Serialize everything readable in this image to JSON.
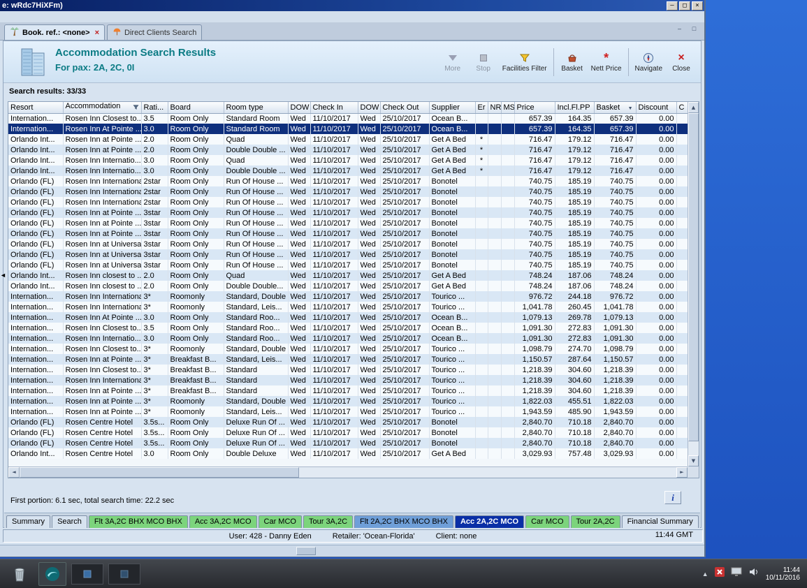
{
  "window": {
    "title": "e: wRdc7HiXFm)",
    "minimize_label": "–",
    "maximize_label": "□",
    "close_label": "×"
  },
  "tabs": [
    {
      "label": "Book. ref.: <none>",
      "active": true
    },
    {
      "label": "Direct Clients Search",
      "active": false
    }
  ],
  "header": {
    "title": "Accommodation Search Results",
    "subtitle": "For pax: 2A, 2C, 0I",
    "toolbar": [
      {
        "label": "More",
        "icon": "chevron-down-icon",
        "disabled": true
      },
      {
        "label": "Stop",
        "icon": "stop-icon",
        "disabled": true
      },
      {
        "label": "Facilities Filter",
        "icon": "funnel-icon",
        "sep_after": true
      },
      {
        "label": "Basket",
        "icon": "basket-icon"
      },
      {
        "label": "Nett Price",
        "icon": "asterisk-icon",
        "sep_after": true
      },
      {
        "label": "Navigate",
        "icon": "compass-icon"
      },
      {
        "label": "Close",
        "icon": "close-x-icon"
      }
    ]
  },
  "results_label": "Search results: 33/33",
  "table": {
    "columns": [
      "Resort",
      "Accommodation",
      "Rati...",
      "Board",
      "Room type",
      "DOW",
      "Check In",
      "DOW",
      "Check Out",
      "Supplier",
      "Er",
      "NR",
      "MS",
      "Price",
      "Incl.Fl.PP",
      "Basket",
      "Discount",
      "C"
    ],
    "selected_index": 1,
    "rows": [
      [
        "Internation...",
        "Rosen Inn Closest to...",
        "3.5",
        "Room Only",
        "Standard Room",
        "Wed",
        "11/10/2017",
        "Wed",
        "25/10/2017",
        "Ocean B...",
        "",
        "",
        "",
        "657.39",
        "164.35",
        "657.39",
        "0.00",
        ""
      ],
      [
        "Internation...",
        "Rosen Inn At Pointe ...",
        "3.0",
        "Room Only",
        "Standard Room",
        "Wed",
        "11/10/2017",
        "Wed",
        "25/10/2017",
        "Ocean B...",
        "",
        "",
        "",
        "657.39",
        "164.35",
        "657.39",
        "0.00",
        ""
      ],
      [
        "Orlando Int...",
        "Rosen Inn at Pointe ...",
        "2.0",
        "Room Only",
        "Quad",
        "Wed",
        "11/10/2017",
        "Wed",
        "25/10/2017",
        "Get A Bed",
        "*",
        "",
        "",
        "716.47",
        "179.12",
        "716.47",
        "0.00",
        ""
      ],
      [
        "Orlando Int...",
        "Rosen Inn at Pointe ...",
        "2.0",
        "Room Only",
        "Double Double ...",
        "Wed",
        "11/10/2017",
        "Wed",
        "25/10/2017",
        "Get A Bed",
        "*",
        "",
        "",
        "716.47",
        "179.12",
        "716.47",
        "0.00",
        ""
      ],
      [
        "Orlando Int...",
        "Rosen Inn Internatio...",
        "3.0",
        "Room Only",
        "Quad",
        "Wed",
        "11/10/2017",
        "Wed",
        "25/10/2017",
        "Get A Bed",
        "*",
        "",
        "",
        "716.47",
        "179.12",
        "716.47",
        "0.00",
        ""
      ],
      [
        "Orlando Int...",
        "Rosen Inn Internatio...",
        "3.0",
        "Room Only",
        "Double Double ...",
        "Wed",
        "11/10/2017",
        "Wed",
        "25/10/2017",
        "Get A Bed",
        "*",
        "",
        "",
        "716.47",
        "179.12",
        "716.47",
        "0.00",
        ""
      ],
      [
        "Orlando (FL)",
        "Rosen Inn International",
        "2star",
        "Room Only",
        "Run Of House ...",
        "Wed",
        "11/10/2017",
        "Wed",
        "25/10/2017",
        "Bonotel",
        "",
        "",
        "",
        "740.75",
        "185.19",
        "740.75",
        "0.00",
        ""
      ],
      [
        "Orlando (FL)",
        "Rosen Inn International",
        "2star",
        "Room Only",
        "Run Of House ...",
        "Wed",
        "11/10/2017",
        "Wed",
        "25/10/2017",
        "Bonotel",
        "",
        "",
        "",
        "740.75",
        "185.19",
        "740.75",
        "0.00",
        ""
      ],
      [
        "Orlando (FL)",
        "Rosen Inn International",
        "2star",
        "Room Only",
        "Run Of House ...",
        "Wed",
        "11/10/2017",
        "Wed",
        "25/10/2017",
        "Bonotel",
        "",
        "",
        "",
        "740.75",
        "185.19",
        "740.75",
        "0.00",
        ""
      ],
      [
        "Orlando (FL)",
        "Rosen Inn at Pointe ...",
        "3star",
        "Room Only",
        "Run Of House ...",
        "Wed",
        "11/10/2017",
        "Wed",
        "25/10/2017",
        "Bonotel",
        "",
        "",
        "",
        "740.75",
        "185.19",
        "740.75",
        "0.00",
        ""
      ],
      [
        "Orlando (FL)",
        "Rosen Inn at Pointe ...",
        "3star",
        "Room Only",
        "Run Of House ...",
        "Wed",
        "11/10/2017",
        "Wed",
        "25/10/2017",
        "Bonotel",
        "",
        "",
        "",
        "740.75",
        "185.19",
        "740.75",
        "0.00",
        ""
      ],
      [
        "Orlando (FL)",
        "Rosen Inn at Pointe ...",
        "3star",
        "Room Only",
        "Run Of House ...",
        "Wed",
        "11/10/2017",
        "Wed",
        "25/10/2017",
        "Bonotel",
        "",
        "",
        "",
        "740.75",
        "185.19",
        "740.75",
        "0.00",
        ""
      ],
      [
        "Orlando (FL)",
        "Rosen Inn at Universal",
        "3star",
        "Room Only",
        "Run Of House ...",
        "Wed",
        "11/10/2017",
        "Wed",
        "25/10/2017",
        "Bonotel",
        "",
        "",
        "",
        "740.75",
        "185.19",
        "740.75",
        "0.00",
        ""
      ],
      [
        "Orlando (FL)",
        "Rosen Inn at Universal",
        "3star",
        "Room Only",
        "Run Of House ...",
        "Wed",
        "11/10/2017",
        "Wed",
        "25/10/2017",
        "Bonotel",
        "",
        "",
        "",
        "740.75",
        "185.19",
        "740.75",
        "0.00",
        ""
      ],
      [
        "Orlando (FL)",
        "Rosen Inn at Universal",
        "3star",
        "Room Only",
        "Run Of House ...",
        "Wed",
        "11/10/2017",
        "Wed",
        "25/10/2017",
        "Bonotel",
        "",
        "",
        "",
        "740.75",
        "185.19",
        "740.75",
        "0.00",
        ""
      ],
      [
        "Orlando Int...",
        "Rosen Inn closest to ...",
        "2.0",
        "Room Only",
        "Quad",
        "Wed",
        "11/10/2017",
        "Wed",
        "25/10/2017",
        "Get A Bed",
        "",
        "",
        "",
        "748.24",
        "187.06",
        "748.24",
        "0.00",
        ""
      ],
      [
        "Orlando Int...",
        "Rosen Inn closest to ...",
        "2.0",
        "Room Only",
        "Double Double...",
        "Wed",
        "11/10/2017",
        "Wed",
        "25/10/2017",
        "Get A Bed",
        "",
        "",
        "",
        "748.24",
        "187.06",
        "748.24",
        "0.00",
        ""
      ],
      [
        "Internation...",
        "Rosen Inn International",
        "3*",
        "Roomonly",
        "Standard, Double",
        "Wed",
        "11/10/2017",
        "Wed",
        "25/10/2017",
        "Tourico ...",
        "",
        "",
        "",
        "976.72",
        "244.18",
        "976.72",
        "0.00",
        ""
      ],
      [
        "Internation...",
        "Rosen Inn International",
        "3*",
        "Roomonly",
        "Standard, Leis...",
        "Wed",
        "11/10/2017",
        "Wed",
        "25/10/2017",
        "Tourico ...",
        "",
        "",
        "",
        "1,041.78",
        "260.45",
        "1,041.78",
        "0.00",
        ""
      ],
      [
        "Internation...",
        "Rosen Inn At Pointe ...",
        "3.0",
        "Room Only",
        "Standard Roo...",
        "Wed",
        "11/10/2017",
        "Wed",
        "25/10/2017",
        "Ocean B...",
        "",
        "",
        "",
        "1,079.13",
        "269.78",
        "1,079.13",
        "0.00",
        ""
      ],
      [
        "Internation...",
        "Rosen Inn Closest to...",
        "3.5",
        "Room Only",
        "Standard Roo...",
        "Wed",
        "11/10/2017",
        "Wed",
        "25/10/2017",
        "Ocean B...",
        "",
        "",
        "",
        "1,091.30",
        "272.83",
        "1,091.30",
        "0.00",
        ""
      ],
      [
        "Internation...",
        "Rosen Inn Internatio...",
        "3.0",
        "Room Only",
        "Standard Roo...",
        "Wed",
        "11/10/2017",
        "Wed",
        "25/10/2017",
        "Ocean B...",
        "",
        "",
        "",
        "1,091.30",
        "272.83",
        "1,091.30",
        "0.00",
        ""
      ],
      [
        "Internation...",
        "Rosen Inn Closest to...",
        "3*",
        "Roomonly",
        "Standard, Double",
        "Wed",
        "11/10/2017",
        "Wed",
        "25/10/2017",
        "Tourico ...",
        "",
        "",
        "",
        "1,098.79",
        "274.70",
        "1,098.79",
        "0.00",
        ""
      ],
      [
        "Internation...",
        "Rosen Inn at Pointe ...",
        "3*",
        "Breakfast B...",
        "Standard, Leis...",
        "Wed",
        "11/10/2017",
        "Wed",
        "25/10/2017",
        "Tourico ...",
        "",
        "",
        "",
        "1,150.57",
        "287.64",
        "1,150.57",
        "0.00",
        ""
      ],
      [
        "Internation...",
        "Rosen Inn Closest to...",
        "3*",
        "Breakfast B...",
        "Standard",
        "Wed",
        "11/10/2017",
        "Wed",
        "25/10/2017",
        "Tourico ...",
        "",
        "",
        "",
        "1,218.39",
        "304.60",
        "1,218.39",
        "0.00",
        ""
      ],
      [
        "Internation...",
        "Rosen Inn International",
        "3*",
        "Breakfast B...",
        "Standard",
        "Wed",
        "11/10/2017",
        "Wed",
        "25/10/2017",
        "Tourico ...",
        "",
        "",
        "",
        "1,218.39",
        "304.60",
        "1,218.39",
        "0.00",
        ""
      ],
      [
        "Internation...",
        "Rosen Inn at Pointe ...",
        "3*",
        "Breakfast B...",
        "Standard",
        "Wed",
        "11/10/2017",
        "Wed",
        "25/10/2017",
        "Tourico ...",
        "",
        "",
        "",
        "1,218.39",
        "304.60",
        "1,218.39",
        "0.00",
        ""
      ],
      [
        "Internation...",
        "Rosen Inn at Pointe ...",
        "3*",
        "Roomonly",
        "Standard, Double",
        "Wed",
        "11/10/2017",
        "Wed",
        "25/10/2017",
        "Tourico ...",
        "",
        "",
        "",
        "1,822.03",
        "455.51",
        "1,822.03",
        "0.00",
        ""
      ],
      [
        "Internation...",
        "Rosen Inn at Pointe ...",
        "3*",
        "Roomonly",
        "Standard, Leis...",
        "Wed",
        "11/10/2017",
        "Wed",
        "25/10/2017",
        "Tourico ...",
        "",
        "",
        "",
        "1,943.59",
        "485.90",
        "1,943.59",
        "0.00",
        ""
      ],
      [
        "Orlando (FL)",
        "Rosen Centre Hotel",
        "3.5s...",
        "Room Only",
        "Deluxe Run Of ...",
        "Wed",
        "11/10/2017",
        "Wed",
        "25/10/2017",
        "Bonotel",
        "",
        "",
        "",
        "2,840.70",
        "710.18",
        "2,840.70",
        "0.00",
        ""
      ],
      [
        "Orlando (FL)",
        "Rosen Centre Hotel",
        "3.5s...",
        "Room Only",
        "Deluxe Run Of ...",
        "Wed",
        "11/10/2017",
        "Wed",
        "25/10/2017",
        "Bonotel",
        "",
        "",
        "",
        "2,840.70",
        "710.18",
        "2,840.70",
        "0.00",
        ""
      ],
      [
        "Orlando (FL)",
        "Rosen Centre Hotel",
        "3.5s...",
        "Room Only",
        "Deluxe Run Of ...",
        "Wed",
        "11/10/2017",
        "Wed",
        "25/10/2017",
        "Bonotel",
        "",
        "",
        "",
        "2,840.70",
        "710.18",
        "2,840.70",
        "0.00",
        ""
      ],
      [
        "Orlando Int...",
        "Rosen Centre Hotel",
        "3.0",
        "Room Only",
        "Double Deluxe",
        "Wed",
        "11/10/2017",
        "Wed",
        "25/10/2017",
        "Get A Bed",
        "",
        "",
        "",
        "3,029.93",
        "757.48",
        "3,029.93",
        "0.00",
        ""
      ]
    ]
  },
  "status": {
    "timing": "First portion: 6.1 sec, total search time: 22.2 sec",
    "info_button": "i"
  },
  "bottom_tabs": [
    {
      "label": "Summary",
      "style": "plain"
    },
    {
      "label": "Search",
      "style": "plain"
    },
    {
      "label": "Flt 3A,2C BHX MCO BHX",
      "style": "green"
    },
    {
      "label": "Acc 3A,2C MCO",
      "style": "green"
    },
    {
      "label": "Car MCO",
      "style": "green"
    },
    {
      "label": "Tour 3A,2C",
      "style": "green"
    },
    {
      "label": "Flt 2A,2C BHX MCO BHX",
      "style": "blue"
    },
    {
      "label": "Acc 2A,2C MCO",
      "style": "selected"
    },
    {
      "label": "Car MCO",
      "style": "green"
    },
    {
      "label": "Tour 2A,2C",
      "style": "green"
    },
    {
      "label": "Financial Summary",
      "style": "plain"
    }
  ],
  "status_bar": {
    "user": "User: 428 - Danny Eden",
    "retailer": "Retailer: 'Ocean-Florida'",
    "client": "Client: none",
    "time": "11:44 GMT"
  },
  "taskbar": {
    "clock_time": "11:44",
    "clock_date": "10/11/2016"
  }
}
